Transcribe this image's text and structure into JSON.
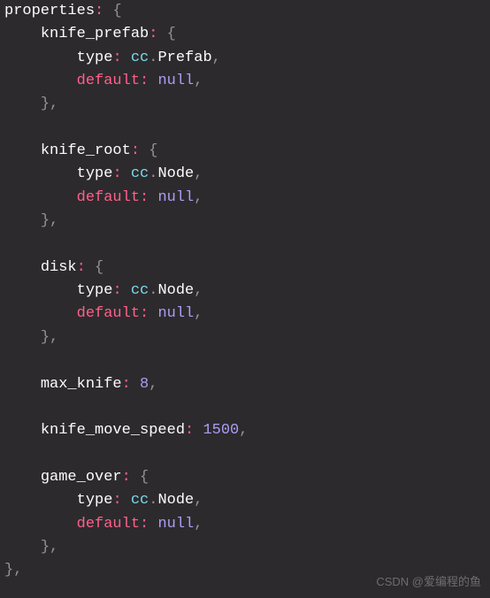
{
  "code": {
    "properties_label": "properties",
    "colon": ":",
    "open_brace": "{",
    "close_brace": "}",
    "comma": ",",
    "props": {
      "knife_prefab": {
        "name": "knife_prefab",
        "type_key": "type",
        "type_ns": "cc",
        "type_val": "Prefab",
        "default_key": "default",
        "default_val": "null"
      },
      "knife_root": {
        "name": "knife_root",
        "type_key": "type",
        "type_ns": "cc",
        "type_val": "Node",
        "default_key": "default",
        "default_val": "null"
      },
      "disk": {
        "name": "disk",
        "type_key": "type",
        "type_ns": "cc",
        "type_val": "Node",
        "default_key": "default",
        "default_val": "null"
      },
      "max_knife": {
        "name": "max_knife",
        "value": "8"
      },
      "knife_move_speed": {
        "name": "knife_move_speed",
        "value": "1500"
      },
      "game_over": {
        "name": "game_over",
        "type_key": "type",
        "type_ns": "cc",
        "type_val": "Node",
        "default_key": "default",
        "default_val": "null"
      }
    }
  },
  "watermark": "CSDN @爱编程的鱼"
}
